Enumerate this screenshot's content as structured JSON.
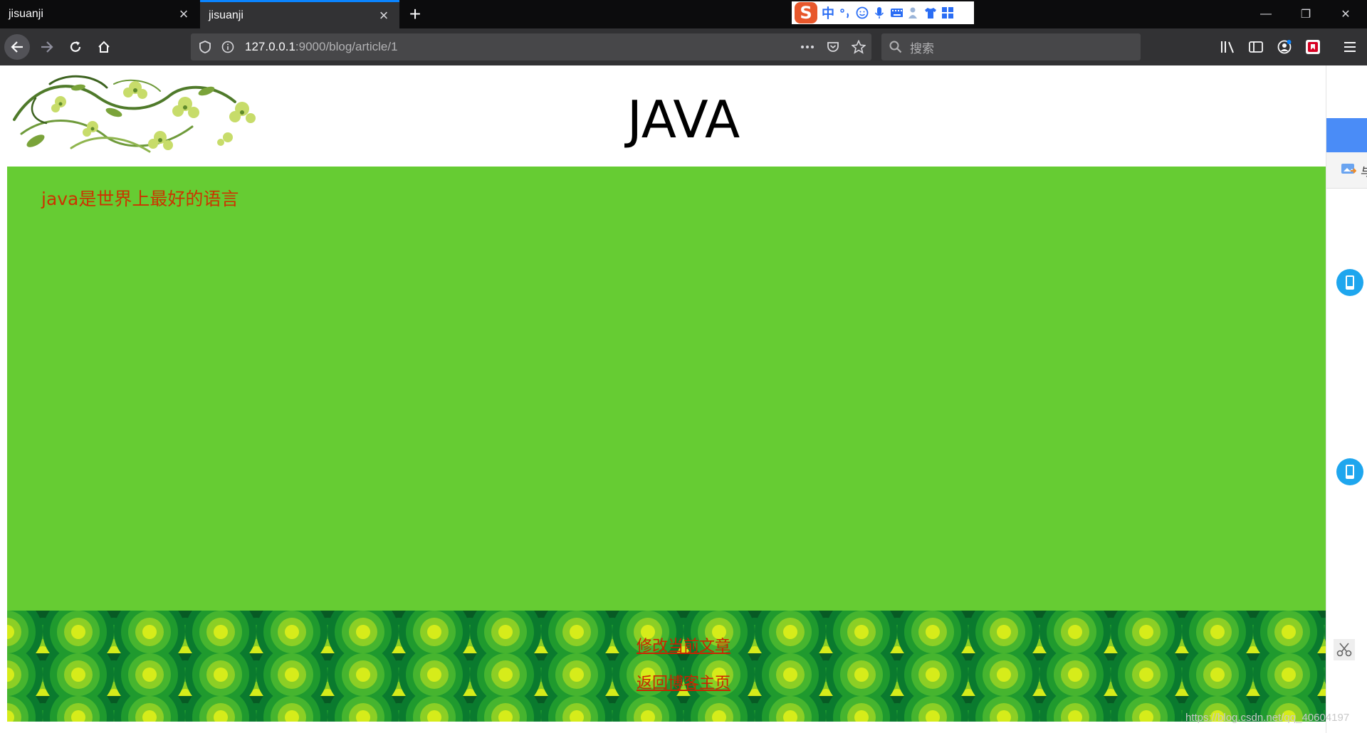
{
  "browser": {
    "tabs": [
      {
        "title": "jisuanji",
        "active": false
      },
      {
        "title": "jisuanji",
        "active": true
      }
    ],
    "ime_label": "中",
    "url_host": "127.0.0.1",
    "url_path": ":9000/blog/article/1",
    "search_placeholder": "搜索"
  },
  "page": {
    "title": "JAVA",
    "article_text": "java是世界上最好的语言",
    "links": {
      "edit": "修改当前文章",
      "home": "返回博客主页"
    },
    "colors": {
      "content_bg": "#66cc33",
      "text": "#cc3300",
      "footer_bg": "#0a6a2e"
    }
  },
  "side_panel": {
    "label": "与"
  },
  "watermark": "https://blog.csdn.net/qq_40604197"
}
